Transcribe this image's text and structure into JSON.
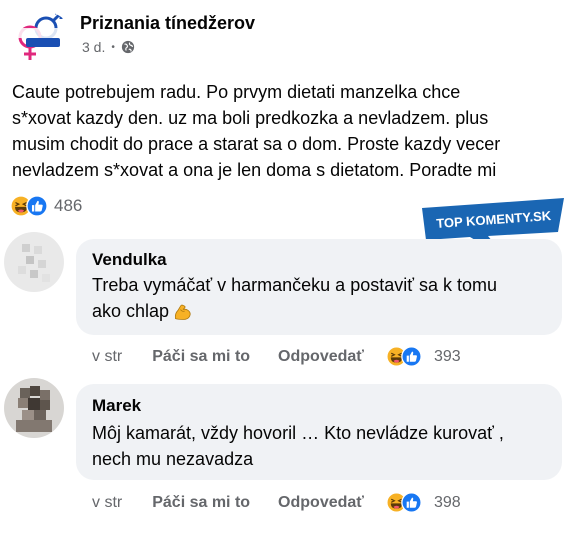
{
  "post": {
    "page_name": "Priznania tínedžerov",
    "avatar_text": "Priznania tínedžerov",
    "time": "3 d.",
    "text_lines": [
      "Caute potrebujem radu. Po prvym dietati manzelka chce",
      "s*xovat kazdy den. uz ma boli predkozka a nevladzem. plus",
      "musim chodit do prace a starat sa o dom. Proste kazdy vecer",
      "nevladzem s*xovat a ona je len doma s dietatom. Poradte mi"
    ],
    "reaction_count": "486"
  },
  "watermark": {
    "text": "TOP KOMENTY.SK"
  },
  "comments": [
    {
      "author": "Vendulka",
      "text_lines": [
        "Treba vymáčať v harmančeku a postaviť sa k tomu",
        "ako chlap"
      ],
      "emoji": "flexed-biceps",
      "time": "v str",
      "like_label": "Páči sa mi to",
      "reply_label": "Odpovedať",
      "reaction_count": "393"
    },
    {
      "author": "Marek",
      "text_lines": [
        "Môj kamarát, vždy hovoril … Kto nevládze kurovať ,",
        "nech mu nezavadza"
      ],
      "time": "v str",
      "like_label": "Páči sa mi to",
      "reply_label": "Odpovedať",
      "reaction_count": "398"
    }
  ],
  "icons": {
    "globe": "globe-icon",
    "haha": "haha-reaction-icon",
    "like": "like-reaction-icon"
  },
  "colors": {
    "like_blue": "#1877f2",
    "haha_yellow": "#f7b125",
    "bubble": "#f0f2f5",
    "secondary_text": "#65676b",
    "watermark_blue": "#1a66b3",
    "logo_pink": "#e0287d"
  }
}
